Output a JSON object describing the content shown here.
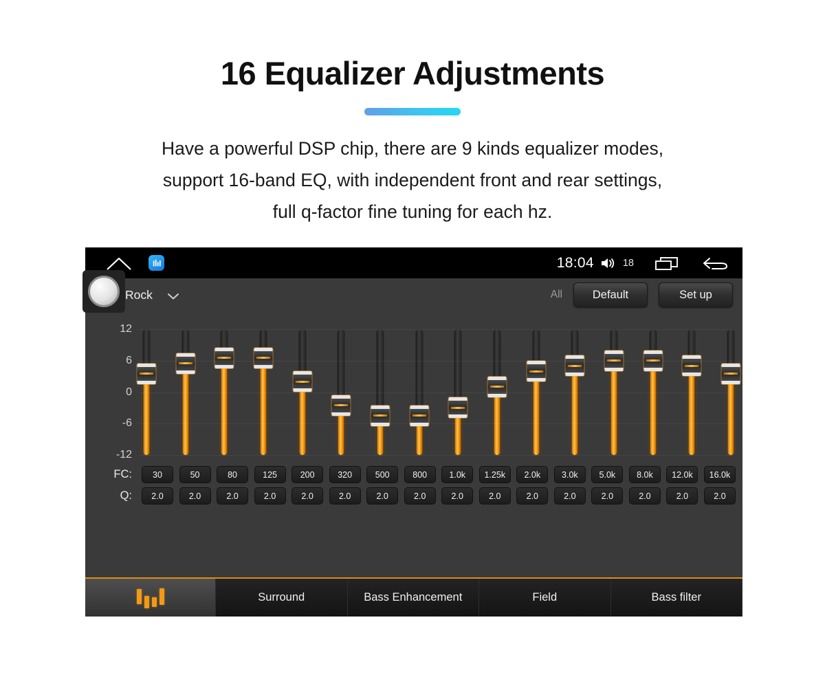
{
  "promo": {
    "title": "16 Equalizer Adjustments",
    "description_lines": [
      "Have a powerful DSP chip, there are 9 kinds equalizer modes,",
      "support 16-band EQ, with independent front and rear settings,",
      "full q-factor fine tuning for each hz."
    ],
    "divider_gradient_from": "#5fa0e6",
    "divider_gradient_to": "#25d8f0",
    "title_color": "#111111"
  },
  "statusbar": {
    "home_icon": "home-icon",
    "app_icon": "equalizer-app-icon",
    "time": "18:04",
    "volume_icon": "volume-icon",
    "volume_level": "18",
    "recents_icon": "recents-icon",
    "back_icon": "back-arrow-icon",
    "background": "#000000"
  },
  "toolbar": {
    "knob_label": "rotary-knob",
    "preset": "Rock",
    "preset_caret": "chevron-down-icon",
    "all_label": "All",
    "default_label": "Default",
    "setup_label": "Set up"
  },
  "equalizer": {
    "accent_color": "#f29a16",
    "panel_background": "#3a3a3a",
    "y_ticks": [
      "12",
      "6",
      "0",
      "-6",
      "-12"
    ],
    "fc_label": "FC:",
    "q_label": "Q:",
    "bands": [
      {
        "fc": "30",
        "q": "2.0",
        "gain": 3.5
      },
      {
        "fc": "50",
        "q": "2.0",
        "gain": 5.5
      },
      {
        "fc": "80",
        "q": "2.0",
        "gain": 6.5
      },
      {
        "fc": "125",
        "q": "2.0",
        "gain": 6.5
      },
      {
        "fc": "200",
        "q": "2.0",
        "gain": 2.0
      },
      {
        "fc": "320",
        "q": "2.0",
        "gain": -2.5
      },
      {
        "fc": "500",
        "q": "2.0",
        "gain": -4.5
      },
      {
        "fc": "800",
        "q": "2.0",
        "gain": -4.5
      },
      {
        "fc": "1.0k",
        "q": "2.0",
        "gain": -3.0
      },
      {
        "fc": "1.25k",
        "q": "2.0",
        "gain": 1.0
      },
      {
        "fc": "2.0k",
        "q": "2.0",
        "gain": 4.0
      },
      {
        "fc": "3.0k",
        "q": "2.0",
        "gain": 5.0
      },
      {
        "fc": "5.0k",
        "q": "2.0",
        "gain": 6.0
      },
      {
        "fc": "8.0k",
        "q": "2.0",
        "gain": 6.0
      },
      {
        "fc": "12.0k",
        "q": "2.0",
        "gain": 5.0
      },
      {
        "fc": "16.0k",
        "q": "2.0",
        "gain": 3.5
      }
    ],
    "gain_min": -12,
    "gain_max": 12
  },
  "tabs": [
    {
      "label": "",
      "icon": "equalizer-icon",
      "active": true
    },
    {
      "label": "Surround",
      "active": false
    },
    {
      "label": "Bass Enhancement",
      "active": false
    },
    {
      "label": "Field",
      "active": false
    },
    {
      "label": "Bass filter",
      "active": false
    }
  ]
}
